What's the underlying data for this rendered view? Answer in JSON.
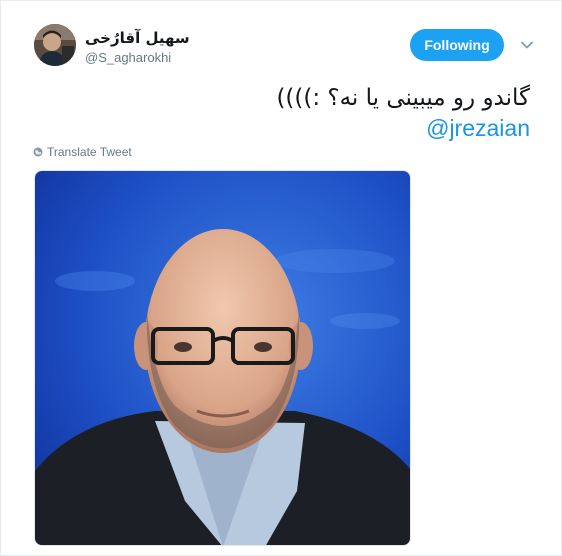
{
  "author": {
    "display_name": "سهیل آقارُخی",
    "handle": "@S_agharokhi"
  },
  "follow_button_label": "Following",
  "tweet": {
    "text_line1": "گاندو رو میبینی یا نه؟ :))))",
    "mention": "@jrezaian"
  },
  "translate_label": "Translate Tweet",
  "icons": {
    "more": "chevron-down-icon",
    "translate": "globe-icon"
  },
  "colors": {
    "accent": "#1da1f2",
    "link": "#1b95e0",
    "secondary_text": "#657786"
  }
}
